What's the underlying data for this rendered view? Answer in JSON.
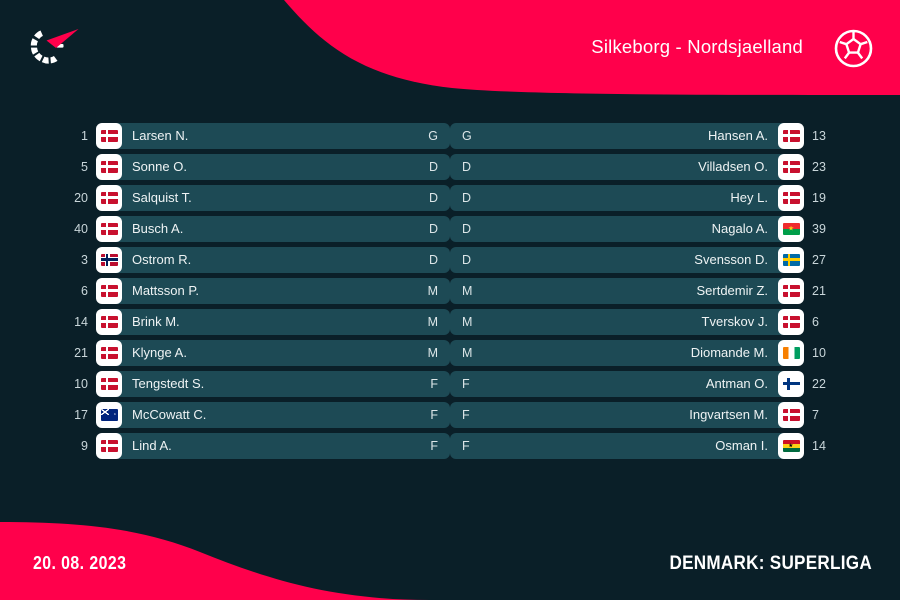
{
  "header": {
    "match_title": "Silkeborg - Nordsjaelland",
    "ball_icon": "soccer-ball-icon",
    "logo_icon": "flashscore-logo-icon",
    "accent_color": "#ff004b",
    "background_color": "#0a1f28"
  },
  "lineups": {
    "home_team": "Silkeborg",
    "away_team": "Nordsjaelland",
    "rows": [
      {
        "home": {
          "number": "1",
          "name": "Larsen N.",
          "position": "G",
          "flag": "dk"
        },
        "away": {
          "number": "13",
          "name": "Hansen A.",
          "position": "G",
          "flag": "dk"
        }
      },
      {
        "home": {
          "number": "5",
          "name": "Sonne O.",
          "position": "D",
          "flag": "dk"
        },
        "away": {
          "number": "23",
          "name": "Villadsen O.",
          "position": "D",
          "flag": "dk"
        }
      },
      {
        "home": {
          "number": "20",
          "name": "Salquist T.",
          "position": "D",
          "flag": "dk"
        },
        "away": {
          "number": "19",
          "name": "Hey L.",
          "position": "D",
          "flag": "dk"
        }
      },
      {
        "home": {
          "number": "40",
          "name": "Busch A.",
          "position": "D",
          "flag": "dk"
        },
        "away": {
          "number": "39",
          "name": "Nagalo A.",
          "position": "D",
          "flag": "bf"
        }
      },
      {
        "home": {
          "number": "3",
          "name": "Ostrom R.",
          "position": "D",
          "flag": "no"
        },
        "away": {
          "number": "27",
          "name": "Svensson D.",
          "position": "D",
          "flag": "se"
        }
      },
      {
        "home": {
          "number": "6",
          "name": "Mattsson P.",
          "position": "M",
          "flag": "dk"
        },
        "away": {
          "number": "21",
          "name": "Sertdemir Z.",
          "position": "M",
          "flag": "dk"
        }
      },
      {
        "home": {
          "number": "14",
          "name": "Brink M.",
          "position": "M",
          "flag": "dk"
        },
        "away": {
          "number": "6",
          "name": "Tverskov J.",
          "position": "M",
          "flag": "dk"
        }
      },
      {
        "home": {
          "number": "21",
          "name": "Klynge A.",
          "position": "M",
          "flag": "dk"
        },
        "away": {
          "number": "10",
          "name": "Diomande M.",
          "position": "M",
          "flag": "ci"
        }
      },
      {
        "home": {
          "number": "10",
          "name": "Tengstedt S.",
          "position": "F",
          "flag": "dk"
        },
        "away": {
          "number": "22",
          "name": "Antman O.",
          "position": "F",
          "flag": "fi"
        }
      },
      {
        "home": {
          "number": "17",
          "name": "McCowatt C.",
          "position": "F",
          "flag": "au"
        },
        "away": {
          "number": "7",
          "name": "Ingvartsen M.",
          "position": "F",
          "flag": "dk"
        }
      },
      {
        "home": {
          "number": "9",
          "name": "Lind A.",
          "position": "F",
          "flag": "dk"
        },
        "away": {
          "number": "14",
          "name": "Osman I.",
          "position": "F",
          "flag": "gh"
        }
      }
    ]
  },
  "footer": {
    "date": "20. 08. 2023",
    "league": "DENMARK: SUPERLIGA"
  }
}
